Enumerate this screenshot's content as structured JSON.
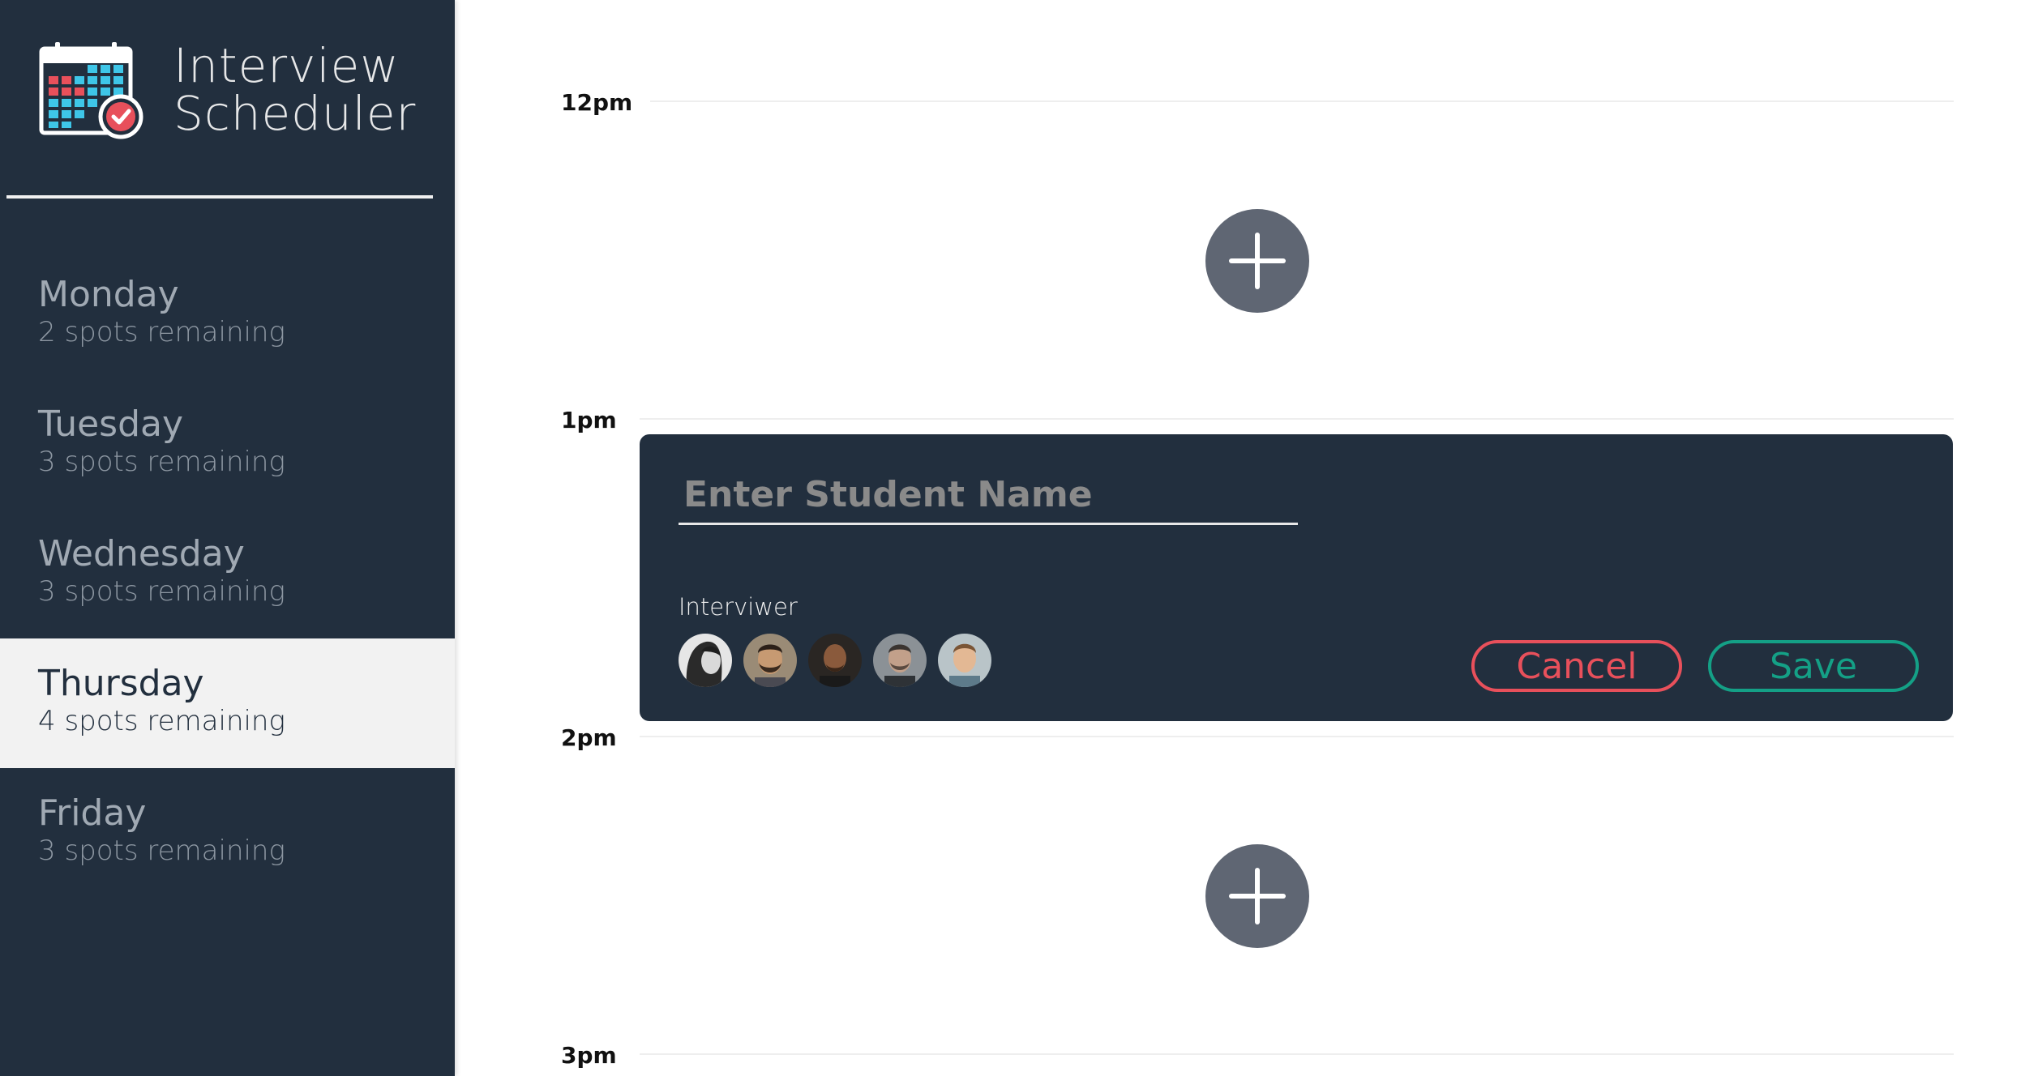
{
  "app": {
    "title_line1": "Interview",
    "title_line2": "Scheduler"
  },
  "days": [
    {
      "name": "Monday",
      "spots": "2 spots remaining",
      "selected": false
    },
    {
      "name": "Tuesday",
      "spots": "3 spots remaining",
      "selected": false
    },
    {
      "name": "Wednesday",
      "spots": "3 spots remaining",
      "selected": false
    },
    {
      "name": "Thursday",
      "spots": "4 spots remaining",
      "selected": true
    },
    {
      "name": "Friday",
      "spots": "3 spots remaining",
      "selected": false
    }
  ],
  "schedule": {
    "hours": [
      "12pm",
      "1pm",
      "2pm",
      "3pm"
    ]
  },
  "form": {
    "student_placeholder": "Enter Student Name",
    "student_value": "",
    "interviewer_label": "Interviwer",
    "cancel_label": "Cancel",
    "save_label": "Save"
  },
  "colors": {
    "sidebar_bg": "#222f3e",
    "selected_bg": "#f2f2f2",
    "add_button": "#5f6673",
    "cancel": "#e8505b",
    "save": "#14a086"
  }
}
